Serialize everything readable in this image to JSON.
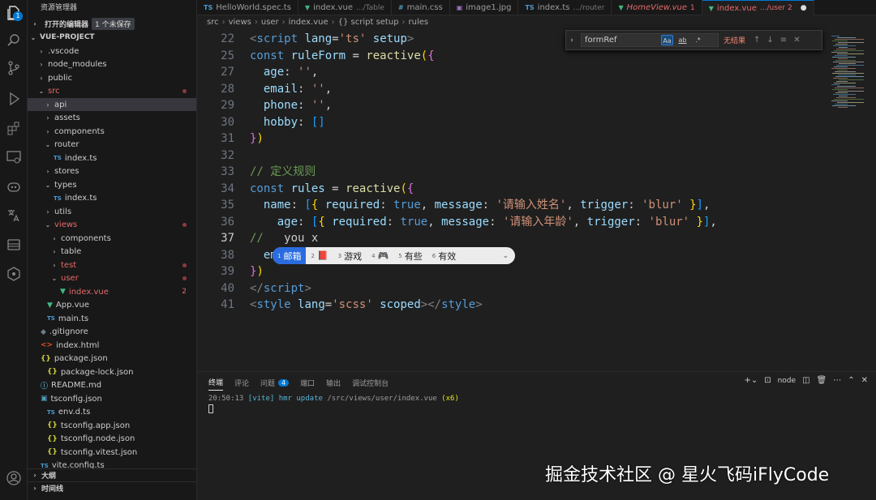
{
  "colors": {
    "accent": "#0078d4",
    "error": "#e46a6a"
  },
  "activity": {
    "icons": [
      "explorer-icon",
      "search-icon",
      "source-control-icon",
      "run-debug-icon",
      "extensions-icon",
      "remote-icon",
      "copilot-icon",
      "translate-icon",
      "database-icon",
      "gitlens-icon",
      "account-icon",
      "settings-icon"
    ],
    "explorer_badge": "1"
  },
  "sidebar": {
    "title": "资源管理器",
    "open_editors": "打开的编辑器",
    "unsaved": "1 个未保存",
    "project": "VUE-PROJECT",
    "tree": [
      {
        "label": ".vscode",
        "kind": "folder",
        "open": false
      },
      {
        "label": "node_modules",
        "kind": "folder",
        "open": false
      },
      {
        "label": "public",
        "kind": "folder",
        "open": false
      },
      {
        "label": "src",
        "kind": "folder",
        "open": true,
        "error": true
      },
      {
        "label": "api",
        "kind": "folder",
        "open": false
      },
      {
        "label": "assets",
        "kind": "folder",
        "open": false
      },
      {
        "label": "components",
        "kind": "folder",
        "open": false
      },
      {
        "label": "router",
        "kind": "folder",
        "open": true
      },
      {
        "label": "index.ts",
        "kind": "ts"
      },
      {
        "label": "stores",
        "kind": "folder",
        "open": false
      },
      {
        "label": "types",
        "kind": "folder",
        "open": true
      },
      {
        "label": "index.ts",
        "kind": "ts"
      },
      {
        "label": "utils",
        "kind": "folder",
        "open": false
      },
      {
        "label": "views",
        "kind": "folder",
        "open": true,
        "error": true
      },
      {
        "label": "components",
        "kind": "folder",
        "open": false
      },
      {
        "label": "table",
        "kind": "folder",
        "open": false
      },
      {
        "label": "test",
        "kind": "folder",
        "open": false,
        "error": true
      },
      {
        "label": "user",
        "kind": "folder",
        "open": true,
        "error": true
      },
      {
        "label": "index.vue",
        "kind": "vue",
        "error": true,
        "count": "2"
      },
      {
        "label": "App.vue",
        "kind": "vue"
      },
      {
        "label": "main.ts",
        "kind": "ts"
      },
      {
        "label": ".gitignore",
        "kind": "git"
      },
      {
        "label": "index.html",
        "kind": "html"
      },
      {
        "label": "package.json",
        "kind": "json",
        "open": true
      },
      {
        "label": "package-lock.json",
        "kind": "json"
      },
      {
        "label": "README.md",
        "kind": "info"
      },
      {
        "label": "tsconfig.json",
        "kind": "cfg",
        "open": true
      },
      {
        "label": "env.d.ts",
        "kind": "ts"
      },
      {
        "label": "tsconfig.app.json",
        "kind": "json"
      },
      {
        "label": "tsconfig.node.json",
        "kind": "json"
      },
      {
        "label": "tsconfig.vitest.json",
        "kind": "json"
      },
      {
        "label": "vite.config.ts",
        "kind": "ts"
      }
    ],
    "outline": "大纲",
    "timeline": "时间线"
  },
  "tabs": [
    {
      "icon": "TS",
      "label": "HelloWorld.spec.ts",
      "sub": ""
    },
    {
      "icon": "▼",
      "label": "index.vue",
      "sub": ".../Table"
    },
    {
      "icon": "#",
      "label": "main.css",
      "sub": ""
    },
    {
      "icon": "▣",
      "label": "image1.jpg",
      "sub": ""
    },
    {
      "icon": "TS",
      "label": "index.ts",
      "sub": ".../router"
    },
    {
      "icon": "▼",
      "label": "HomeView.vue",
      "sub": "1"
    },
    {
      "icon": "▼",
      "label": "index.vue",
      "sub": ".../user 2"
    }
  ],
  "breadcrumb": [
    "src",
    "views",
    "user",
    "index.vue",
    "{} script setup",
    "rules"
  ],
  "find": {
    "value": "formRef",
    "opt_case": "Aa",
    "opt_word": "ab",
    "opt_regex": ".*",
    "result": "无结果"
  },
  "editor": {
    "lines": [
      {
        "n": "22",
        "html": "<span class='tag'>&lt;</span><span class='kw'>script</span> <span class='var'>lang</span>=<span class='str'>'ts'</span> <span class='var'>setup</span><span class='tag'>&gt;</span>"
      },
      {
        "n": "25",
        "html": "<span class='kw'>const</span> <span class='var'>ruleForm</span> = <span class='fn'>reactive</span><span class='br1'>(</span><span class='br2'>{</span>"
      },
      {
        "n": "27",
        "html": "  <span class='var'>age</span>: <span class='str'>''</span>,"
      },
      {
        "n": "28",
        "html": "  <span class='var'>email</span>: <span class='str'>''</span>,"
      },
      {
        "n": "29",
        "html": "  <span class='var'>phone</span>: <span class='str'>''</span>,"
      },
      {
        "n": "30",
        "html": "  <span class='var'>hobby</span>: <span class='br3'>[]</span>"
      },
      {
        "n": "31",
        "html": "<span class='br2'>}</span><span class='br1'>)</span>"
      },
      {
        "n": "32",
        "html": ""
      },
      {
        "n": "33",
        "html": "<span class='cm'>// 定义规则</span>"
      },
      {
        "n": "34",
        "html": "<span class='kw'>const</span> <span class='var'>rules</span> = <span class='fn'>reactive</span><span class='br1'>(</span><span class='br2'>{</span>"
      },
      {
        "n": "35",
        "html": "  <span class='var'>name</span>: <span class='br3'>[</span><span class='br1'>{</span> <span class='var'>required</span>: <span class='kw'>true</span>, <span class='var'>message</span>: <span class='str'>'请输入姓名'</span>, <span class='var'>trigger</span>: <span class='str'>'blur'</span> <span class='br1'>}</span><span class='br3'>]</span>,"
      },
      {
        "n": "36",
        "html": "    <span class='var'>age</span>: <span class='br3'>[</span><span class='br1'>{</span> <span class='var'>required</span>: <span class='kw'>true</span>, <span class='var'>message</span>: <span class='str'>'请输入年龄'</span>, <span class='var'>trigger</span>: <span class='str'>'blur'</span> <span class='br1'>}</span><span class='br3'>]</span>,"
      },
      {
        "n": "37",
        "html": "<span class='cm'>//</span>   <span class='sc'>you x</span>",
        "current": true
      },
      {
        "n": "38",
        "html": "  <span class='var'>em</span>"
      },
      {
        "n": "39",
        "html": "<span class='br2'>}</span><span class='br1'>)</span>"
      },
      {
        "n": "40",
        "html": "<span class='tag'>&lt;/</span><span class='kw'>script</span><span class='tag'>&gt;</span>"
      },
      {
        "n": "41",
        "html": "<span class='tag'>&lt;</span><span class='kw'>style</span> <span class='var'>lang</span>=<span class='str'>'scss'</span> <span class='var'>scoped</span><span class='tag'>&gt;&lt;/</span><span class='kw'>style</span><span class='tag'>&gt;</span>"
      }
    ]
  },
  "ime": {
    "candidates": [
      {
        "n": "1",
        "text": "邮箱",
        "selected": true
      },
      {
        "n": "2",
        "text": "",
        "emoji": "📕"
      },
      {
        "n": "3",
        "text": "游戏"
      },
      {
        "n": "4",
        "text": "",
        "emoji": "🎮"
      },
      {
        "n": "5",
        "text": "有些"
      },
      {
        "n": "6",
        "text": "有效"
      }
    ],
    "more": "⌄"
  },
  "panel": {
    "tabs": [
      "终端",
      "评论",
      "问题",
      "端口",
      "输出",
      "调试控制台"
    ],
    "problems_badge": "4",
    "shell": "node",
    "term_time": "20:50:13",
    "term_tag": "[vite]",
    "term_msg": "hmr update",
    "term_path": "/src/views/user/index.vue",
    "term_count": "(x6)"
  },
  "watermark": "掘金技术社区 @ 星火飞码iFlyCode"
}
